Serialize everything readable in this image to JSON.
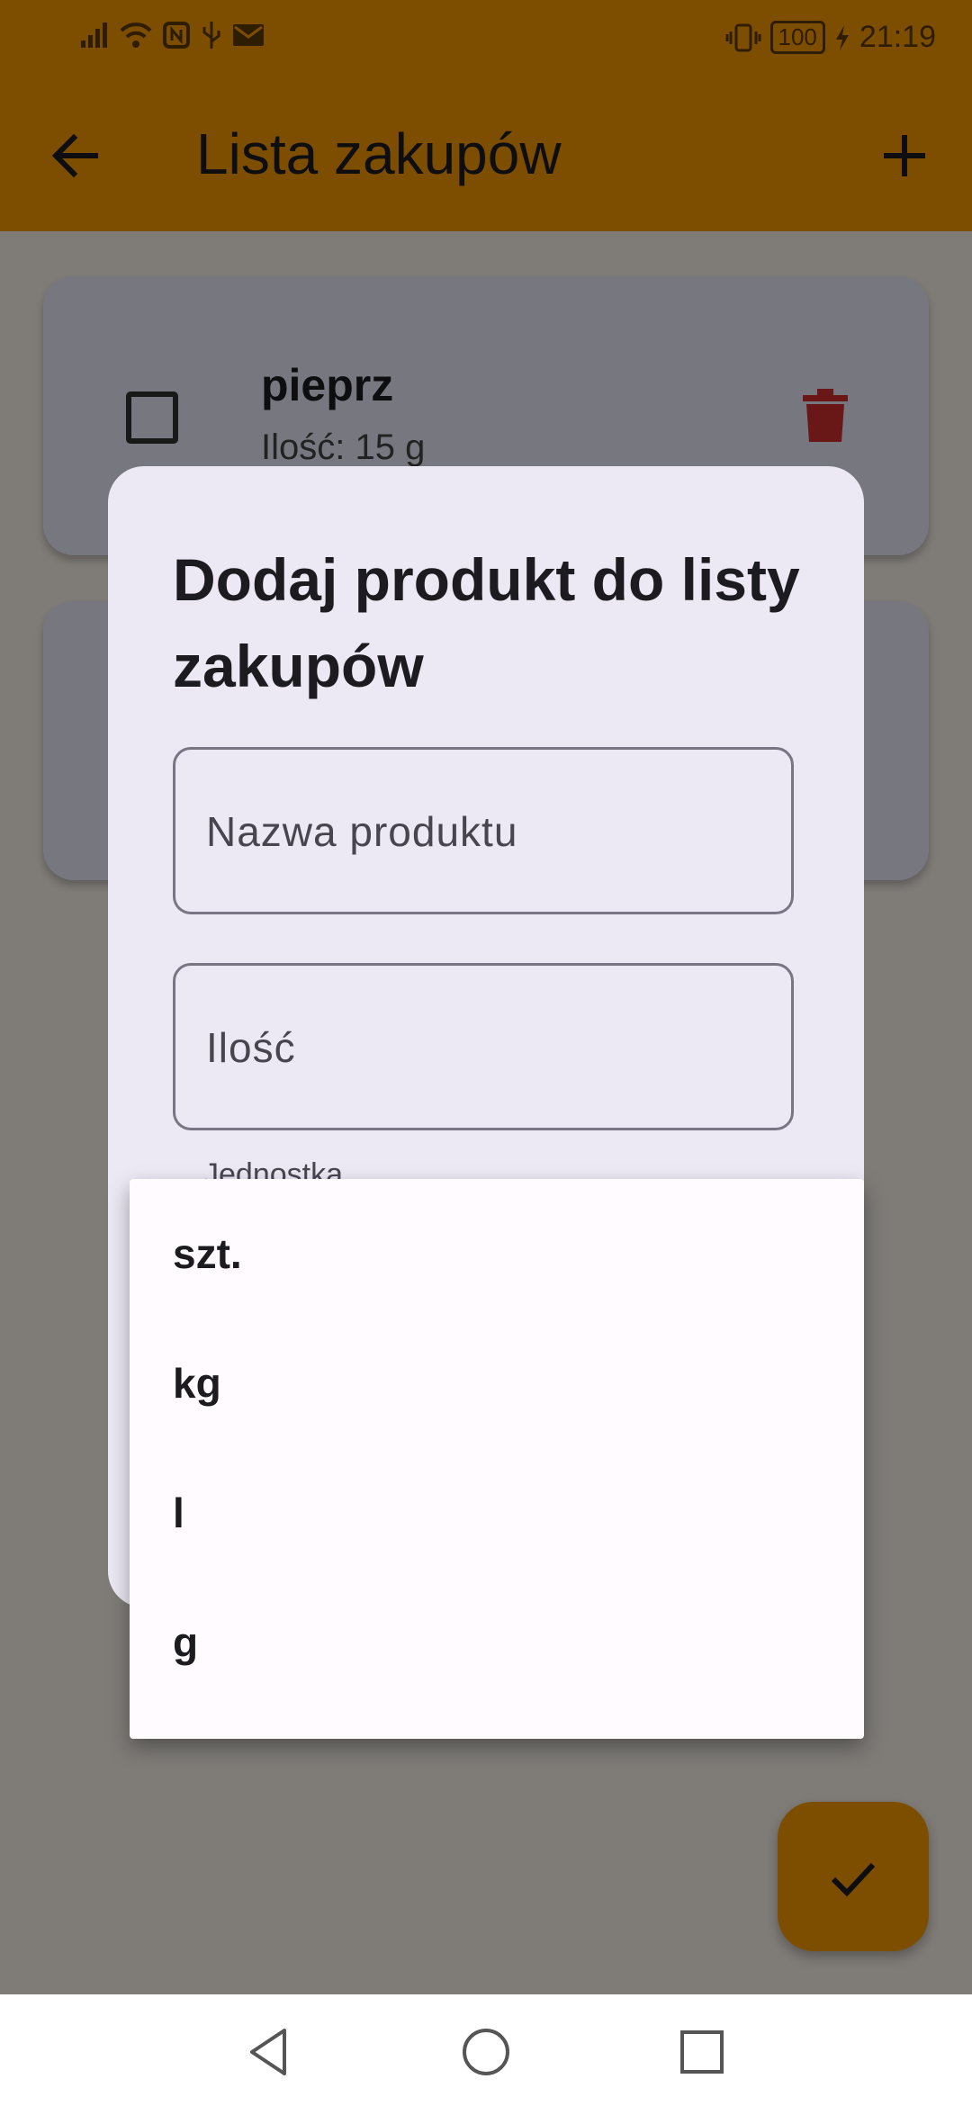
{
  "status_bar": {
    "battery": "100",
    "time": "21:19",
    "icons": [
      "signal-icon",
      "wifi-icon",
      "nfc-icon",
      "usb-icon",
      "mail-icon",
      "vibrate-icon",
      "battery-icon",
      "charging-icon"
    ]
  },
  "app_bar": {
    "title": "Lista zakupów"
  },
  "items": [
    {
      "name": "pieprz",
      "quantity": "Ilość: 15 g"
    }
  ],
  "dialog": {
    "title": "Dodaj produkt do listy zakupów",
    "product_name_placeholder": "Nazwa produktu",
    "quantity_placeholder": "Ilość",
    "unit_label": "Jednostka"
  },
  "unit_menu": {
    "options": [
      "szt.",
      "kg",
      "l",
      "g"
    ]
  },
  "colors": {
    "accent": "#fb9c00",
    "delete": "#d32f2f",
    "dialog_bg": "#ece8f4",
    "menu_bg": "#fffbfe"
  }
}
